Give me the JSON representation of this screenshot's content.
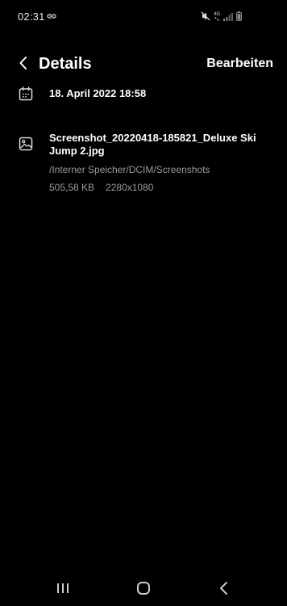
{
  "status": {
    "time": "02:31",
    "network": "4G"
  },
  "header": {
    "title": "Details",
    "edit_label": "Bearbeiten"
  },
  "details": {
    "date_time": "18. April 2022 18:58",
    "file_name": "Screenshot_20220418-185821_Deluxe Ski Jump 2.jpg",
    "file_path": "/Interner Speicher/DCIM/Screenshots",
    "file_size": "505,58 KB",
    "resolution": "2280x1080"
  },
  "icons": {
    "back": "back-arrow-icon",
    "calendar": "calendar-icon",
    "image": "image-icon",
    "mute": "mute-icon",
    "signal": "signal-icon",
    "battery": "battery-icon",
    "link": "link-icon"
  }
}
